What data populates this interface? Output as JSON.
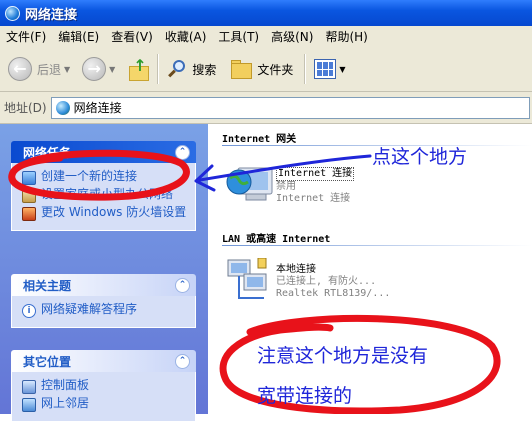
{
  "window": {
    "title": "网络连接"
  },
  "menu": [
    "文件(F)",
    "编辑(E)",
    "查看(V)",
    "收藏(A)",
    "工具(T)",
    "高级(N)",
    "帮助(H)"
  ],
  "toolbar": {
    "back": "后退",
    "search": "搜索",
    "folders": "文件夹"
  },
  "address": {
    "label": "地址(D)",
    "value": "网络连接"
  },
  "sidebar": {
    "network_tasks": {
      "title": "网络任务",
      "items": [
        "创建一个新的连接",
        "设置家庭或小型办公网络",
        "更改 Windows 防火墙设置"
      ]
    },
    "see_also": {
      "title": "相关主题",
      "items": [
        "网络疑难解答程序"
      ]
    },
    "other_places": {
      "title": "其它位置",
      "items": [
        "控制面板",
        "网上邻居"
      ]
    }
  },
  "content": {
    "group1": {
      "title": "Internet 网关",
      "item": {
        "name": "Internet 连接",
        "status": "禁用",
        "device": "Internet 连接"
      }
    },
    "group2": {
      "title": "LAN 或高速 Internet",
      "item": {
        "name": "本地连接",
        "status": "已连接上, 有防火...",
        "device": "Realtek RTL8139/..."
      }
    }
  },
  "annotations": {
    "arrow_note": "点这个地方",
    "bottom_note_line1": "注意这个地方是没有",
    "bottom_note_line2": "宽带连接的",
    "color": "#1f26d9",
    "highlight_color": "#e8121a"
  }
}
